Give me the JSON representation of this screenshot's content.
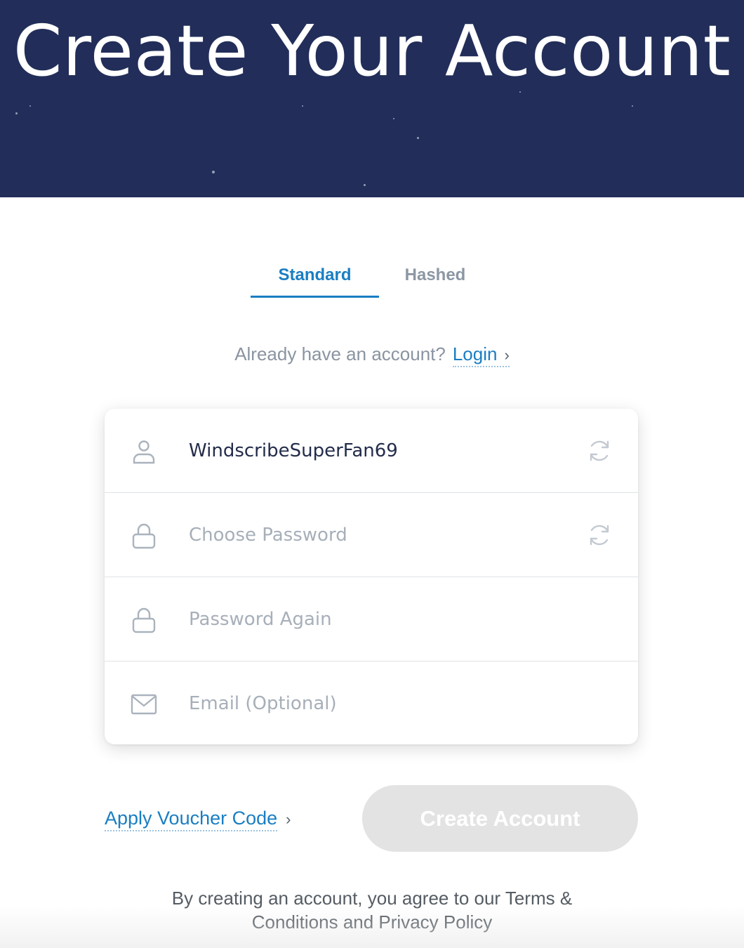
{
  "hero": {
    "title": "Create Your Account",
    "background": "#222e59"
  },
  "tabs": [
    {
      "label": "Standard",
      "active": true
    },
    {
      "label": "Hashed",
      "active": false
    }
  ],
  "login_prompt": {
    "question": "Already have an account?",
    "link_label": "Login",
    "chevron": "›"
  },
  "form": {
    "username": {
      "value": "WindscribeSuperFan69",
      "icon": "user-icon",
      "regen_icon": "refresh-icon"
    },
    "password": {
      "placeholder": "Choose Password",
      "icon": "lock-icon",
      "regen_icon": "refresh-icon"
    },
    "password_again": {
      "placeholder": "Password Again",
      "icon": "lock-icon"
    },
    "email": {
      "placeholder": "Email (Optional)",
      "icon": "envelope-icon"
    }
  },
  "voucher": {
    "label": "Apply Voucher Code",
    "chevron": "›"
  },
  "create_button": {
    "label": "Create Account",
    "enabled": false
  },
  "legal": {
    "line1": "By creating an account, you agree to our Terms &",
    "line2": "Conditions and Privacy Policy"
  },
  "colors": {
    "accent": "#1a7ec2",
    "muted": "#8a94a1",
    "button_disabled": "#e3e3e3"
  }
}
